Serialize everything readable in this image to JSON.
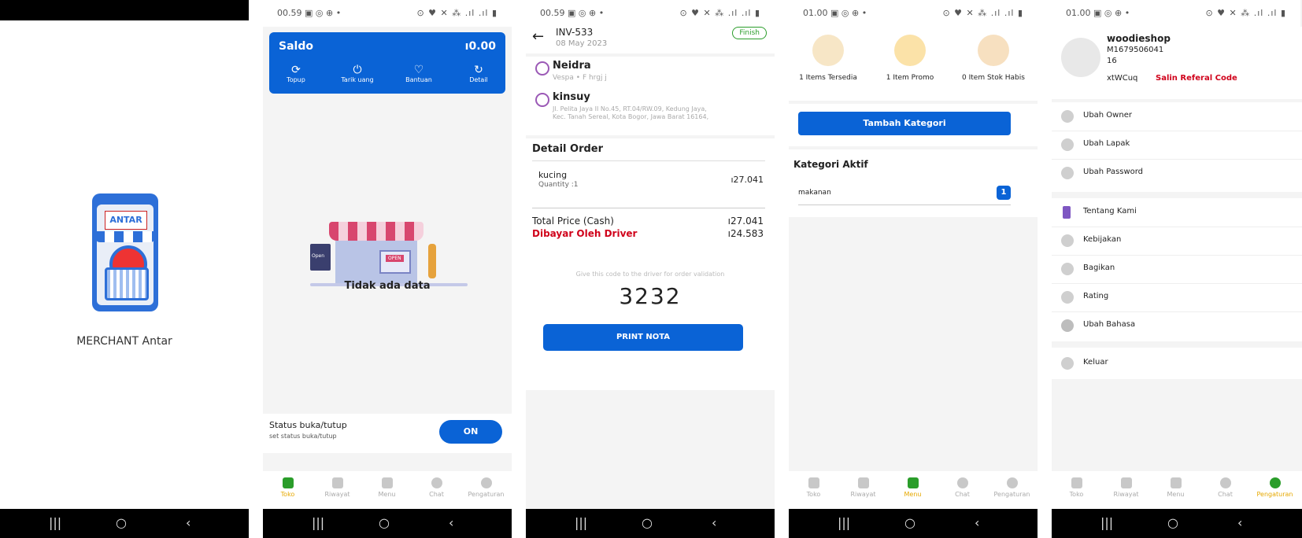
{
  "splash": {
    "app_name": "MERCHANT Antar",
    "logo_text": "ANTAR"
  },
  "status_times": [
    "00.59",
    "00.59",
    "01.00",
    "01.00"
  ],
  "status_icons": "▣ ◎ ⊕ •",
  "status_right": "⊙ ♥ ✕ ⁂ .ıl .ıl ▮",
  "nav": {
    "recent": "|||",
    "home": "○",
    "back": "‹"
  },
  "tabs": [
    "Toko",
    "Riwayat",
    "Menu",
    "Chat",
    "Pengaturan"
  ],
  "toko": {
    "saldo_label": "Saldo",
    "saldo_value": "ı0.00",
    "actions": [
      {
        "label": "Topup",
        "icon": "refresh-icon"
      },
      {
        "label": "Tarik uang",
        "icon": "power-icon"
      },
      {
        "label": "Bantuan",
        "icon": "chat-icon"
      },
      {
        "label": "Detail",
        "icon": "history-icon"
      }
    ],
    "empty_text": "Tidak ada data",
    "status_title": "Status buka/tutup",
    "status_sub": "set status buka/tutup",
    "toggle_label": "ON",
    "store_sign": "Open",
    "store_awning_label": "OPEN"
  },
  "order": {
    "invoice": "INV-533",
    "date": "08 May 2023",
    "status_badge": "Finish",
    "driver_name": "Neidra",
    "driver_vehicle": "Vespa • F hrgj j",
    "customer_name": "kinsuy",
    "customer_address_1": "Jl. Pelita Jaya II No.45, RT.04/RW.09, Kedung Jaya,",
    "customer_address_2": "Kec. Tanah Sereal, Kota Bogor, Jawa Barat 16164,",
    "detail_title": "Detail Order",
    "item_name": "kucing",
    "item_qty": "Quantity :1",
    "item_price": "ı27.041",
    "total_label": "Total Price (Cash)",
    "total_value": "ı27.041",
    "driver_paid_label": "Dibayar Oleh Driver",
    "driver_paid_value": "ı24.583",
    "code_hint": "Give this code to the driver for order validation",
    "code": "3232",
    "print_label": "PRINT NOTA"
  },
  "menu": {
    "stats": [
      {
        "label": "1 Items Tersedia"
      },
      {
        "label": "1 Item Promo"
      },
      {
        "label": "0 Item Stok Habis"
      }
    ],
    "add_category_label": "Tambah Kategori",
    "active_title": "Kategori Aktif",
    "category_name": "makanan",
    "category_count": "1"
  },
  "settings": {
    "shop_name": "woodieshop",
    "merchant_id": "M1679506041",
    "merchant_id_2": "16",
    "referral_code": "xtWCuq",
    "copy_referral_label": "Salin Referal Code",
    "group1": [
      "Ubah Owner",
      "Ubah Lapak",
      "Ubah Password"
    ],
    "group2": [
      "Tentang Kami",
      "Kebijakan",
      "Bagikan",
      "Rating",
      "Ubah Bahasa"
    ],
    "logout_label": "Keluar"
  },
  "colors": {
    "primary": "#0a63d6",
    "accent_red": "#d0021b",
    "active_green": "#2a9d2a",
    "active_tab_text": "#e6a800",
    "badge_green": "#2a9d2a"
  }
}
